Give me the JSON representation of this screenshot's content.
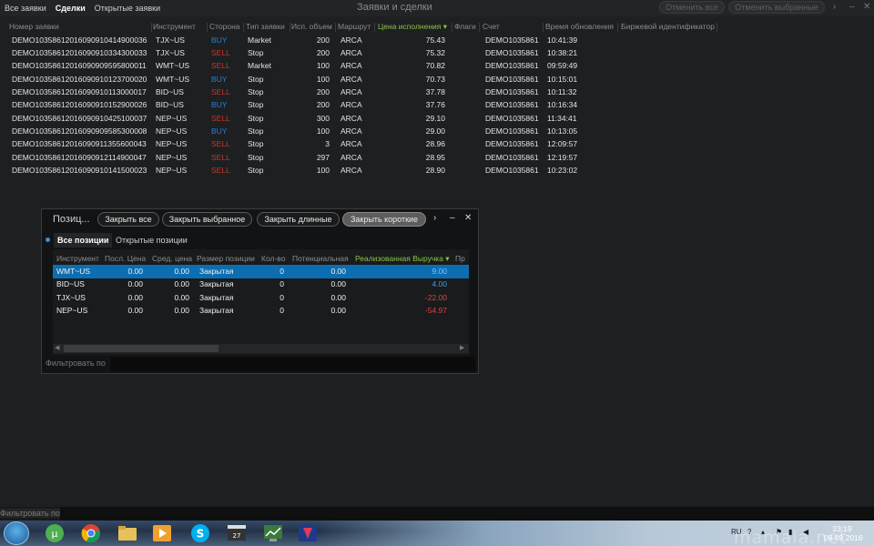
{
  "top_tabs": [
    "Все заявки",
    "Сделки",
    "Открытые заявки"
  ],
  "window_title": "Заявки и сделки",
  "top_buttons": {
    "cancel_all": "Отменить все",
    "cancel_selected": "Отменить выбранные"
  },
  "orders": {
    "columns": [
      "Номер заявки",
      "Инструмент",
      "Сторона",
      "Тип заявки",
      "Исп. объем",
      "Маршрут",
      "Цена исполнения ▾",
      "Флаги",
      "Счет",
      "Время обновления",
      "Биржевой идентификатор"
    ],
    "rows": [
      [
        "DEMO10358612016090910414900036",
        "TJX~US",
        "BUY",
        "Market",
        "200",
        "ARCA",
        "75.43",
        "",
        "DEMO1035861",
        "10:41:39"
      ],
      [
        "DEMO10358612016090910334300033",
        "TJX~US",
        "SELL",
        "Stop",
        "200",
        "ARCA",
        "75.32",
        "",
        "DEMO1035861",
        "10:38:21"
      ],
      [
        "DEMO10358612016090909595800011",
        "WMT~US",
        "SELL",
        "Market",
        "100",
        "ARCA",
        "70.82",
        "",
        "DEMO1035861",
        "09:59:49"
      ],
      [
        "DEMO10358612016090910123700020",
        "WMT~US",
        "BUY",
        "Stop",
        "100",
        "ARCA",
        "70.73",
        "",
        "DEMO1035861",
        "10:15:01"
      ],
      [
        "DEMO10358612016090910113000017",
        "BID~US",
        "SELL",
        "Stop",
        "200",
        "ARCA",
        "37.78",
        "",
        "DEMO1035861",
        "10:11:32"
      ],
      [
        "DEMO10358612016090910152900026",
        "BID~US",
        "BUY",
        "Stop",
        "200",
        "ARCA",
        "37.76",
        "",
        "DEMO1035861",
        "10:16:34"
      ],
      [
        "DEMO10358612016090910425100037",
        "NEP~US",
        "SELL",
        "Stop",
        "300",
        "ARCA",
        "29.10",
        "",
        "DEMO1035861",
        "11:34:41"
      ],
      [
        "DEMO10358612016090909585300008",
        "NEP~US",
        "BUY",
        "Stop",
        "100",
        "ARCA",
        "29.00",
        "",
        "DEMO1035861",
        "10:13:05"
      ],
      [
        "DEMO10358612016090911355600043",
        "NEP~US",
        "SELL",
        "Stop",
        "3",
        "ARCA",
        "28.96",
        "",
        "DEMO1035861",
        "12:09:57"
      ],
      [
        "DEMO10358612016090912114900047",
        "NEP~US",
        "SELL",
        "Stop",
        "297",
        "ARCA",
        "28.95",
        "",
        "DEMO1035861",
        "12:19:57"
      ],
      [
        "DEMO10358612016090910141500023",
        "NEP~US",
        "SELL",
        "Stop",
        "100",
        "ARCA",
        "28.90",
        "",
        "DEMO1035861",
        "10:23:02"
      ]
    ]
  },
  "positions": {
    "title": "Позиц...",
    "buttons": [
      "Закрыть все",
      "Закрыть выбранное",
      "Закрыть длинные",
      "Закрыть короткие"
    ],
    "tabs": [
      "Все позиции",
      "Открытые позиции"
    ],
    "columns": [
      "Инструмент",
      "Посл. Цена",
      "Сред. цена",
      "Размер позиции",
      "Кол-во",
      "Потенциальная",
      "Реализованная Выручка ▾",
      "Пр"
    ],
    "rows": [
      [
        "WMT~US",
        "0.00",
        "0.00",
        "Закрытая",
        "0",
        "0.00",
        "9.00"
      ],
      [
        "BID~US",
        "0.00",
        "0.00",
        "Закрытая",
        "0",
        "0.00",
        "4.00"
      ],
      [
        "TJX~US",
        "0.00",
        "0.00",
        "Закрытая",
        "0",
        "0.00",
        "-22.00"
      ],
      [
        "NEP~US",
        "0.00",
        "0.00",
        "Закрытая",
        "0",
        "0.00",
        "-54.97"
      ]
    ],
    "filter_label": "Фильтровать по"
  },
  "bottom_filter_label": "Фильтровать по",
  "taskbar": {
    "lang": "RU",
    "time": "23:19",
    "date": "09.09.2016"
  },
  "watermark": "mamaia.net",
  "colors": {
    "buy": "#2a7fd4",
    "sell": "#c0392b",
    "sort_header": "#8bc34a",
    "selected_row": "#0c6eb0",
    "profit": "#3f9bea",
    "loss": "#e04040"
  }
}
